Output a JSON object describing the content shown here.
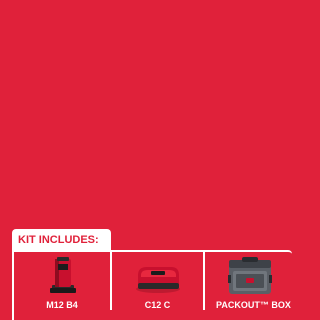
{
  "kit": {
    "heading": "KIT INCLUDES:",
    "items": [
      {
        "label": "M12 B4",
        "icon": "battery-icon"
      },
      {
        "label": "C12 C",
        "icon": "charger-icon"
      },
      {
        "label": "PACKOUT™ BOX",
        "icon": "toolbox-icon"
      }
    ]
  },
  "colors": {
    "background": "#e0213a",
    "panel": "#ffffff"
  }
}
